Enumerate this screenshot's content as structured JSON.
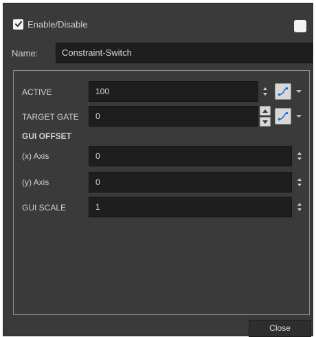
{
  "header": {
    "enable_label": "Enable/Disable",
    "enable_checked": true
  },
  "name_field": {
    "label": "Name:",
    "value": "Constraint-Switch"
  },
  "attributes": {
    "active": {
      "label": "ACTIVE",
      "value": "100"
    },
    "target_gate": {
      "label": "TARGET GATE",
      "value": "0"
    },
    "gui_offset": {
      "title": "GUI OFFSET",
      "x_axis": {
        "label": "(x) Axis",
        "value": "0"
      },
      "y_axis": {
        "label": "(y) Axis",
        "value": "0"
      }
    },
    "gui_scale": {
      "label": "GUI SCALE",
      "value": "1"
    }
  },
  "footer": {
    "close_label": "Close"
  },
  "colors": {
    "dialog_bg": "#3a3a3a",
    "field_bg": "#1e1e1e",
    "function_icon": "#1f6fd1",
    "text": "#d6d6d6"
  },
  "icons": {
    "checkbox": "checkmark-icon",
    "function": "function-curve-icon",
    "dropdown": "chevron-down-icon",
    "spin": "spin-arrows-icon"
  }
}
